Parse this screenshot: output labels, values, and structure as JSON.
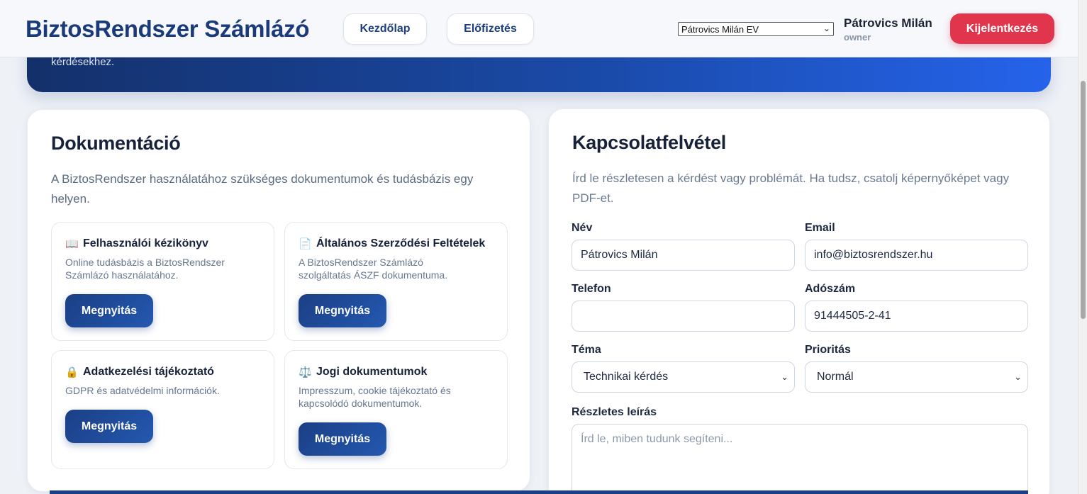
{
  "header": {
    "brand": "BiztosRendszer Számlázó",
    "nav": {
      "home": "Kezdőlap",
      "subscription": "Előfizetés"
    },
    "company_select": "Pátrovics Milán EV",
    "user": {
      "name": "Pátrovics Milán",
      "role": "owner"
    },
    "logout": "Kijelentkezés"
  },
  "hero": {
    "text_fragment": "kérdésekhez."
  },
  "docs": {
    "title": "Dokumentáció",
    "description": "A BiztosRendszer használatához szükséges dokumentumok és tudásbázis egy helyen.",
    "items": [
      {
        "icon": "book-icon",
        "glyph": "📖",
        "title": "Felhasználói kézikönyv",
        "description": "Online tudásbázis a BiztosRendszer Számlázó használatához.",
        "button": "Megnyitás"
      },
      {
        "icon": "document-icon",
        "glyph": "📄",
        "title": "Általános Szerződési Feltételek",
        "description": "A BiztosRendszer Számlázó szolgáltatás ÁSZF dokumentuma.",
        "button": "Megnyitás"
      },
      {
        "icon": "lock-icon",
        "glyph": "🔒",
        "title": "Adatkezelési tájékoztató",
        "description": "GDPR és adatvédelmi információk.",
        "button": "Megnyitás"
      },
      {
        "icon": "scales-icon",
        "glyph": "⚖️",
        "title": "Jogi dokumentumok",
        "description": "Impresszum, cookie tájékoztató és kapcsolódó dokumentumok.",
        "button": "Megnyitás"
      }
    ]
  },
  "contact": {
    "title": "Kapcsolatfelvétel",
    "description": "Írd le részletesen a kérdést vagy problémát. Ha tudsz, csatolj képernyőképet vagy PDF-et.",
    "fields": {
      "name": {
        "label": "Név",
        "value": "Pátrovics Milán"
      },
      "email": {
        "label": "Email",
        "value": "info@biztosrendszer.hu"
      },
      "phone": {
        "label": "Telefon",
        "value": ""
      },
      "tax": {
        "label": "Adószám",
        "value": "91444505-2-41"
      },
      "topic": {
        "label": "Téma",
        "value": "Technikai kérdés"
      },
      "priority": {
        "label": "Prioritás",
        "value": "Normál"
      },
      "details": {
        "label": "Részletes leírás",
        "placeholder": "Írd le, miben tudunk segíteni..."
      }
    }
  }
}
